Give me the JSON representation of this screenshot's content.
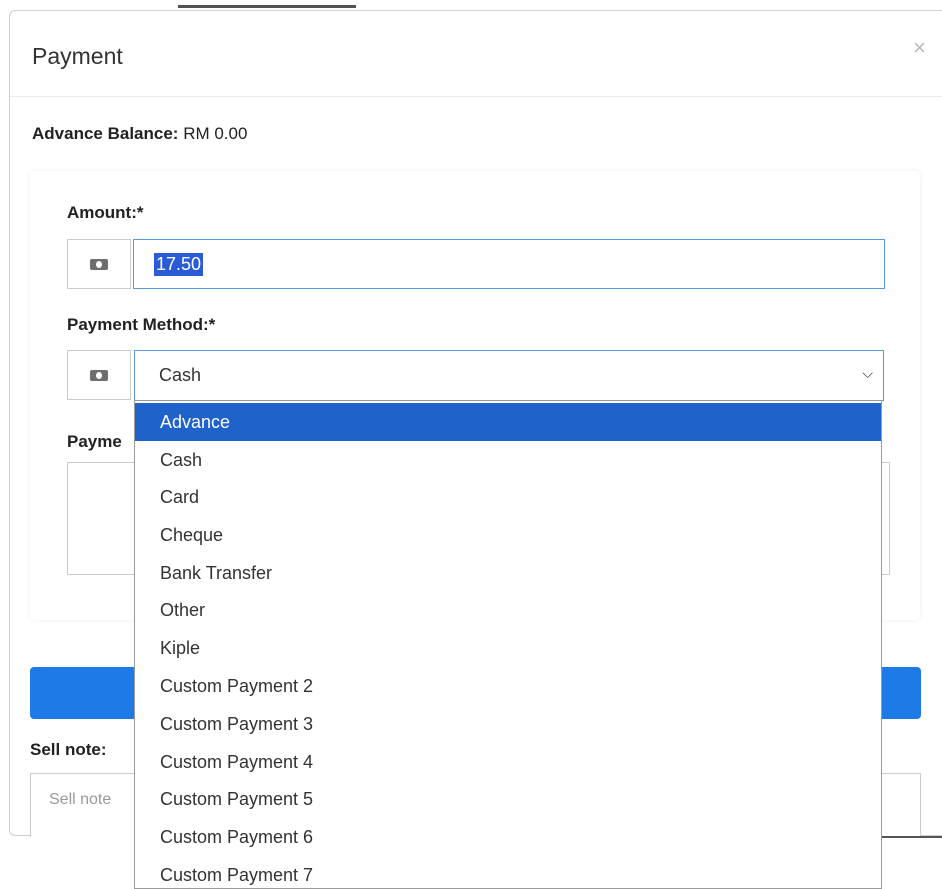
{
  "modal": {
    "title": "Payment",
    "close_symbol": "×"
  },
  "advance_balance": {
    "label": "Advance Balance:",
    "value": "RM 0.00"
  },
  "amount": {
    "label": "Amount:*",
    "value": "17.50",
    "icon": "money-icon"
  },
  "payment_method": {
    "label": "Payment Method:*",
    "selected": "Cash",
    "icon": "money-icon",
    "options": [
      "Advance",
      "Cash",
      "Card",
      "Cheque",
      "Bank Transfer",
      "Other",
      "Kiple",
      "Custom Payment 2",
      "Custom Payment 3",
      "Custom Payment 4",
      "Custom Payment 5",
      "Custom Payment 6",
      "Custom Payment 7"
    ],
    "highlighted_option": "Advance"
  },
  "payment_note": {
    "label_partial": "Payme"
  },
  "sell_note": {
    "label": "Sell note:",
    "placeholder": "Sell note"
  },
  "colors": {
    "primary_button": "#1e7ae6",
    "highlight": "#1f62c9",
    "focus_border": "#5b9bd5"
  }
}
